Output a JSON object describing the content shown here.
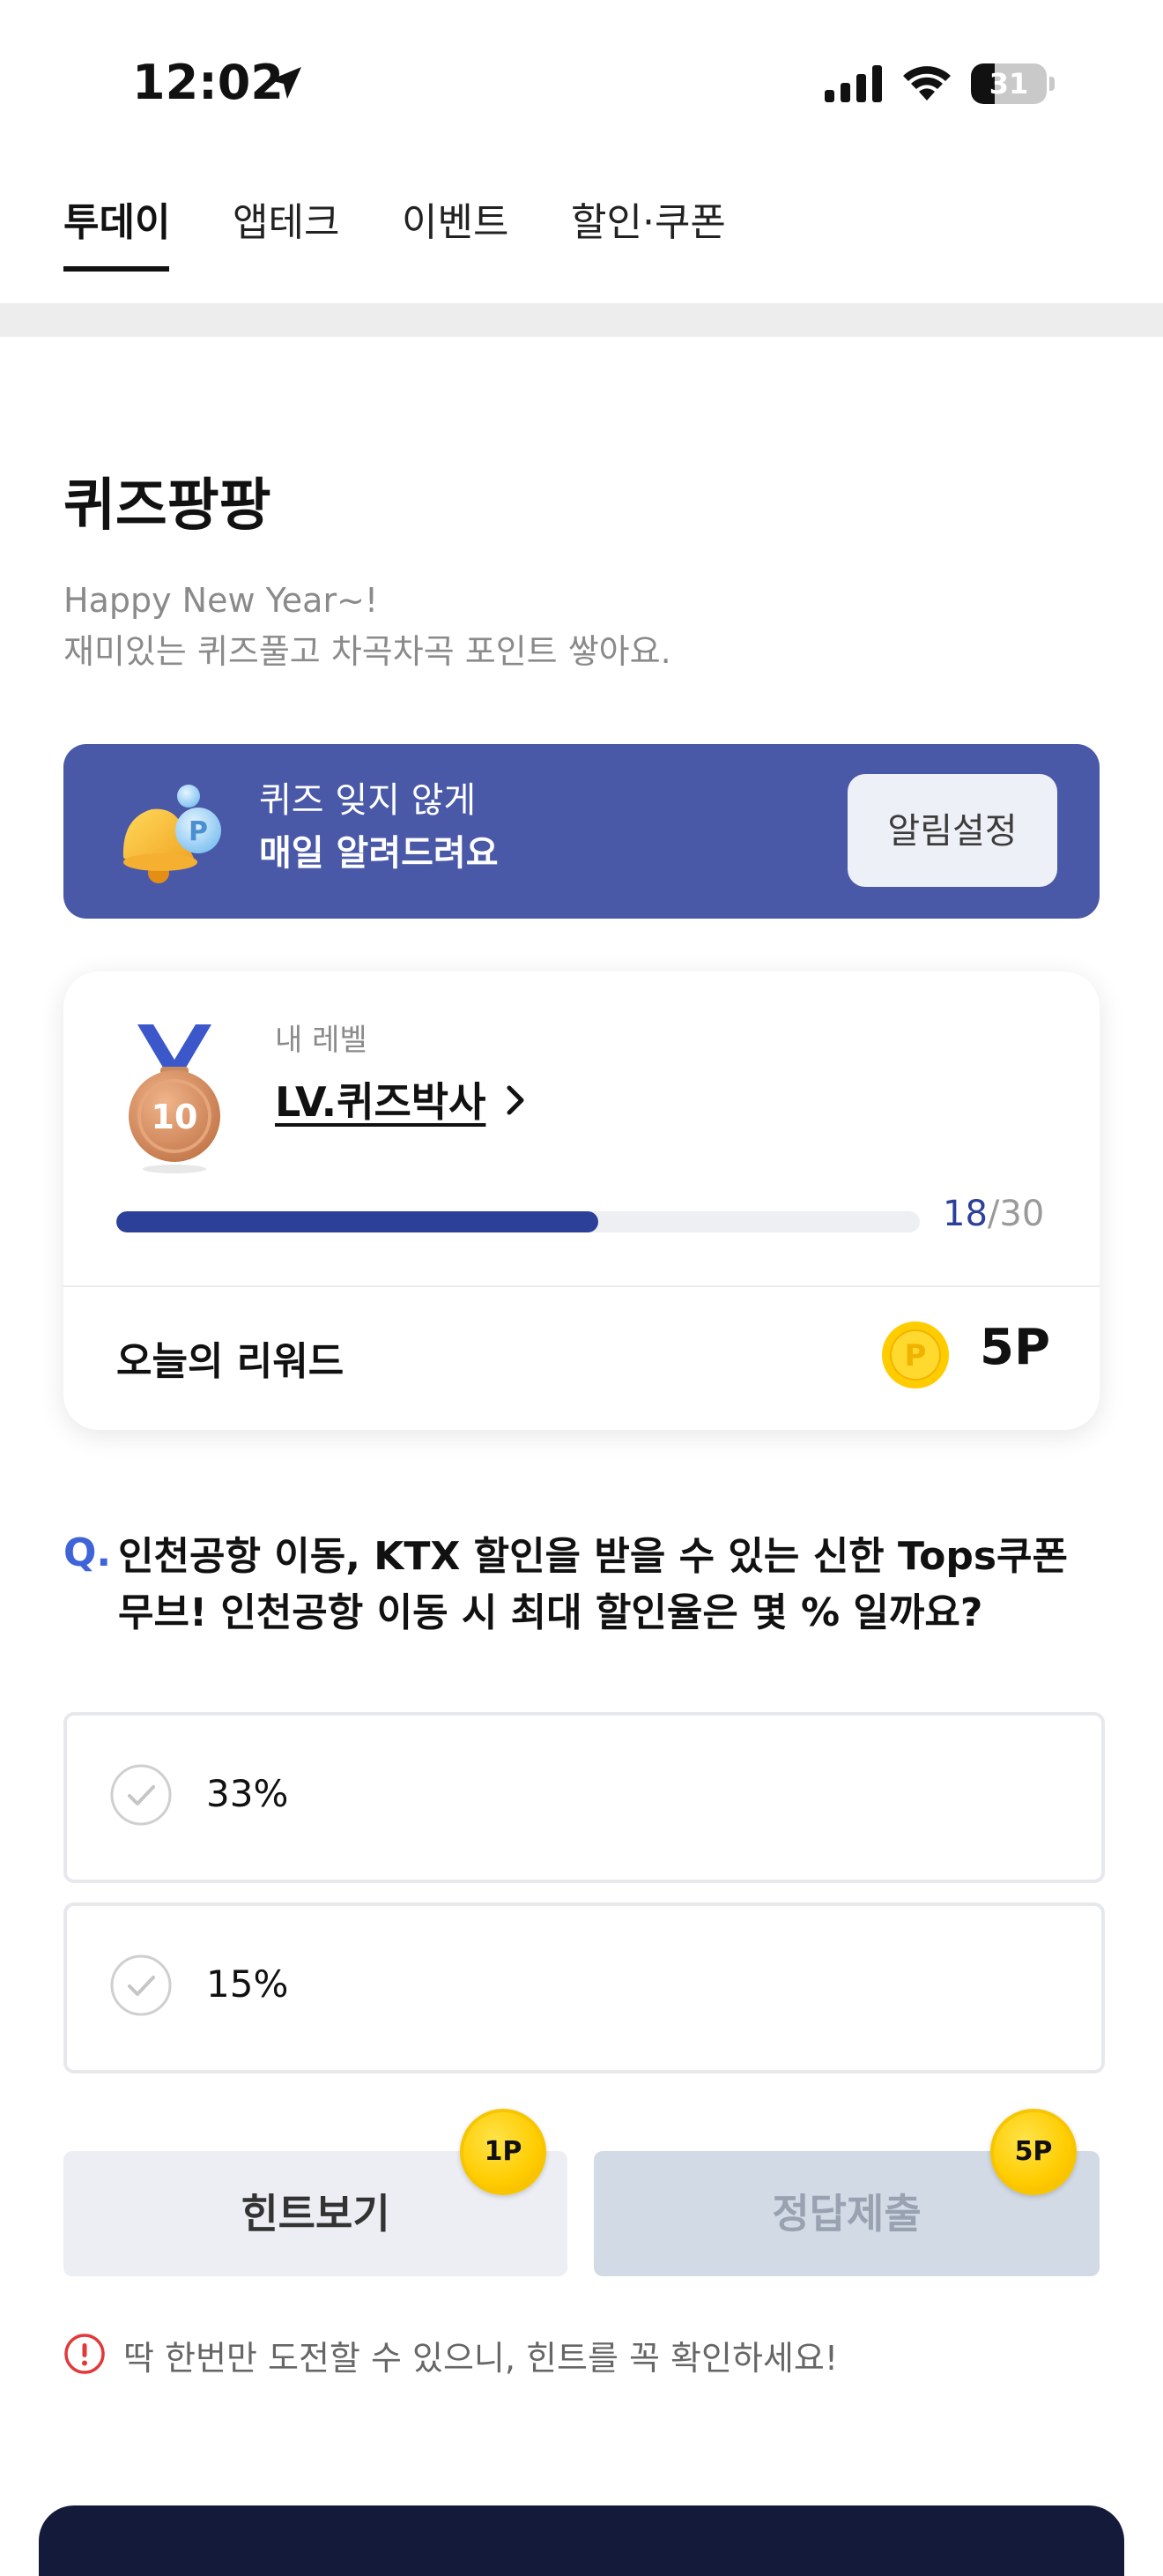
{
  "status_bar": {
    "time": "12:02",
    "battery_level": "31",
    "battery_fraction": 0.31
  },
  "tabs": [
    {
      "label": "투데이",
      "active": true
    },
    {
      "label": "앱테크",
      "active": false
    },
    {
      "label": "이벤트",
      "active": false
    },
    {
      "label": "할인·쿠폰",
      "active": false
    }
  ],
  "page": {
    "title": "퀴즈팡팡",
    "subtitle_line1": "Happy New Year~!",
    "subtitle_line2": "재미있는 퀴즈풀고 차곡차곡 포인트 쌓아요."
  },
  "notify_banner": {
    "line1": "퀴즈 잊지 않게",
    "line2": "매일 알려드려요",
    "button_label": "알림설정",
    "background_color": "#4959a8"
  },
  "level_card": {
    "caption": "내 레벨",
    "level_name": "LV.퀴즈박사",
    "medal_number": "10",
    "progress_current": "18",
    "progress_separator": "/",
    "progress_total": "30",
    "progress_fraction": 0.6,
    "reward_label": "오늘의 리워드",
    "reward_value": "5P"
  },
  "question": {
    "marker": "Q.",
    "text": "인천공항 이동, KTX 할인을 받을 수 있는 신한 Tops쿠폰 무브! 인천공항 이동 시 최대 할인율은 몇 % 일까요?"
  },
  "options": [
    {
      "label": "33%"
    },
    {
      "label": "15%"
    }
  ],
  "actions": {
    "hint_label": "힌트보기",
    "hint_cost": "1P",
    "submit_label": "정답제출",
    "submit_reward": "5P"
  },
  "warning": {
    "text": "딱 한번만 도전할 수 있으니, 힌트를 꼭 확인하세요!"
  },
  "colors": {
    "accent": "#2c3f99",
    "question_marker": "#3f63d8",
    "coin": "#ffcc00",
    "warning": "#e03a3a"
  }
}
